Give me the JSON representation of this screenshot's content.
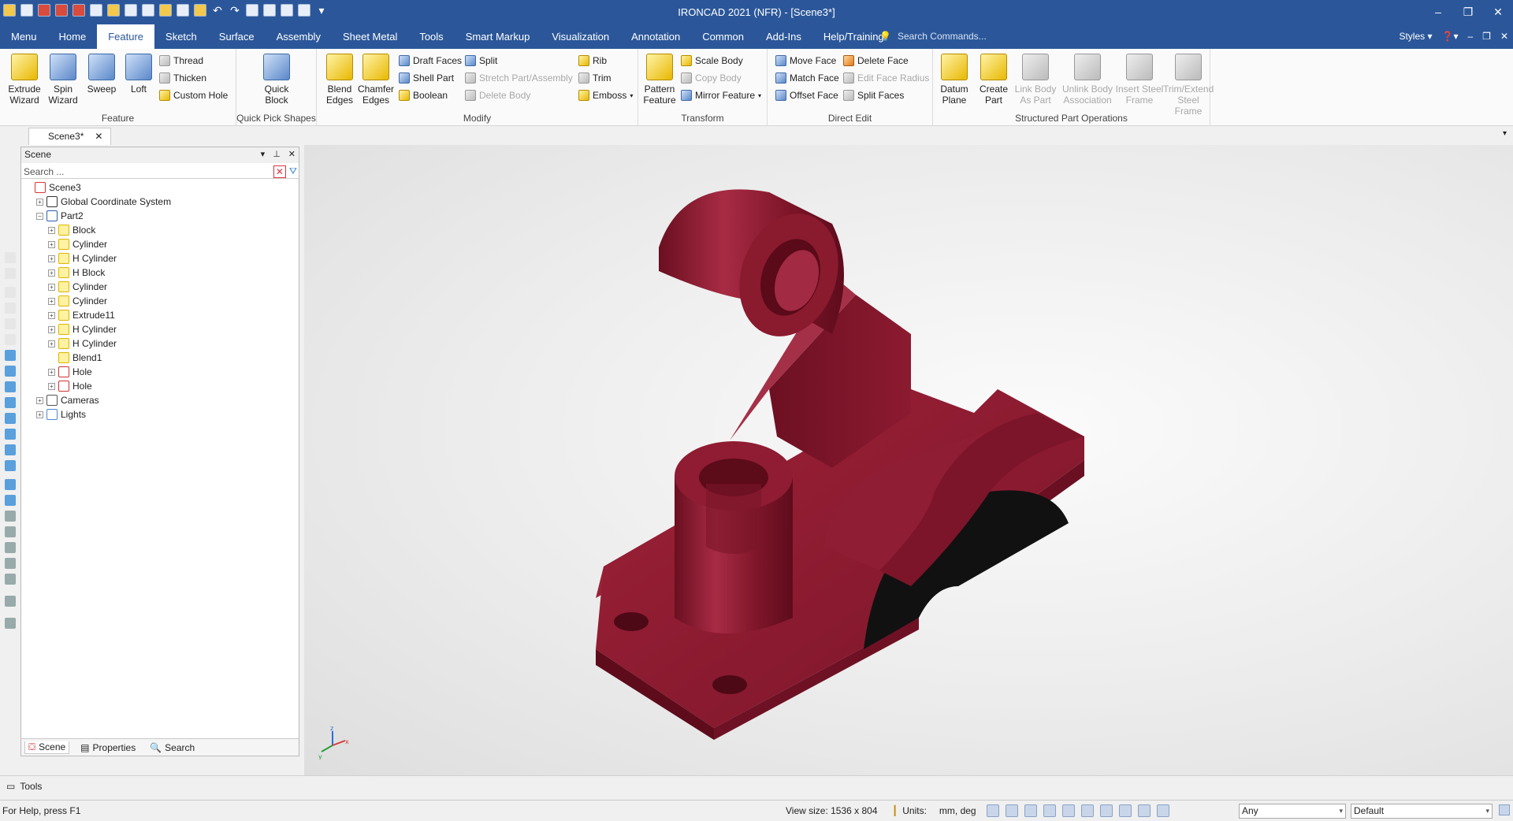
{
  "window": {
    "title": "IRONCAD 2021 (NFR) - [Scene3*]",
    "controls": [
      "–",
      "❐",
      "✕"
    ]
  },
  "ribbon_tabs": [
    "Menu",
    "Home",
    "Feature",
    "Sketch",
    "Surface",
    "Assembly",
    "Sheet Metal",
    "Tools",
    "Smart Markup",
    "Visualization",
    "Annotation",
    "Common",
    "Add-Ins",
    "Help/Training"
  ],
  "active_tab": "Feature",
  "command_search": {
    "placeholder": "Search Commands..."
  },
  "styles_label": "Styles",
  "groups": {
    "feature": {
      "label": "Feature",
      "extrude": "Extrude\nWizard",
      "spin": "Spin\nWizard",
      "sweep": "Sweep",
      "loft": "Loft",
      "thread": "Thread",
      "thicken": "Thicken",
      "custom_hole": "Custom Hole"
    },
    "quick_pick": {
      "label": "Quick Pick Shapes",
      "quick_block": "Quick\nBlock"
    },
    "modify": {
      "label": "Modify",
      "blend": "Blend\nEdges",
      "chamfer": "Chamfer\nEdges",
      "draft": "Draft Faces",
      "shell": "Shell Part",
      "boolean": "Boolean",
      "split": "Split",
      "stretch": "Stretch Part/Assembly",
      "delete_body": "Delete Body",
      "rib": "Rib",
      "trim": "Trim",
      "emboss": "Emboss"
    },
    "transform": {
      "label": "Transform",
      "pattern": "Pattern\nFeature",
      "scale": "Scale Body",
      "copy": "Copy Body",
      "mirror": "Mirror Feature"
    },
    "direct_edit": {
      "label": "Direct Edit",
      "move": "Move Face",
      "match": "Match Face",
      "offset": "Offset Face",
      "delete_face": "Delete Face",
      "edit_radius": "Edit Face Radius",
      "split_faces": "Split Faces"
    },
    "structured": {
      "label": "Structured Part Operations",
      "datum": "Datum\nPlane",
      "create_part": "Create\nPart",
      "link_body": "Link Body\nAs Part",
      "unlink": "Unlink Body\nAssociation",
      "insert_steel": "Insert Steel\nFrame",
      "trim_steel": "Trim/Extend\nSteel Frame"
    }
  },
  "doc_tab": "Scene3*",
  "scene_panel": {
    "title": "Scene",
    "search_placeholder": "Search ...",
    "tree": [
      {
        "label": "Scene3",
        "level": 0,
        "exp": "",
        "icon": "scene-icon"
      },
      {
        "label": "Global Coordinate System",
        "level": 1,
        "exp": "+",
        "icon": "axes-icon"
      },
      {
        "label": "Part2",
        "level": 1,
        "exp": "−",
        "icon": "part-icon"
      },
      {
        "label": "Block",
        "level": 2,
        "exp": "+",
        "icon": "feature-icon"
      },
      {
        "label": "Cylinder",
        "level": 2,
        "exp": "+",
        "icon": "feature-icon"
      },
      {
        "label": "H Cylinder",
        "level": 2,
        "exp": "+",
        "icon": "feature-icon"
      },
      {
        "label": "H Block",
        "level": 2,
        "exp": "+",
        "icon": "feature-icon"
      },
      {
        "label": "Cylinder",
        "level": 2,
        "exp": "+",
        "icon": "feature-icon"
      },
      {
        "label": "Cylinder",
        "level": 2,
        "exp": "+",
        "icon": "feature-icon"
      },
      {
        "label": "Extrude11",
        "level": 2,
        "exp": "+",
        "icon": "feature-icon"
      },
      {
        "label": "H Cylinder",
        "level": 2,
        "exp": "+",
        "icon": "feature-icon"
      },
      {
        "label": "H Cylinder",
        "level": 2,
        "exp": "+",
        "icon": "feature-icon"
      },
      {
        "label": "Blend1",
        "level": 2,
        "exp": "",
        "icon": "blend-icon"
      },
      {
        "label": "Hole",
        "level": 2,
        "exp": "+",
        "icon": "hole-icon"
      },
      {
        "label": "Hole",
        "level": 2,
        "exp": "+",
        "icon": "hole-icon"
      },
      {
        "label": "Cameras",
        "level": 1,
        "exp": "+",
        "icon": "camera-icon"
      },
      {
        "label": "Lights",
        "level": 1,
        "exp": "+",
        "icon": "light-icon"
      }
    ],
    "bottom_tabs": [
      "Scene",
      "Properties",
      "Search"
    ]
  },
  "tools_bar": {
    "label": "Tools"
  },
  "status": {
    "help": "For Help, press F1",
    "view_size": "View size: 1536 x  804",
    "units_label": "Units:",
    "units_value": "mm, deg",
    "filter_any": "Any",
    "style_default": "Default"
  },
  "colors": {
    "title_bar": "#2b579a",
    "model": "#8a1a2e",
    "viewport_bg": "#ececec"
  }
}
